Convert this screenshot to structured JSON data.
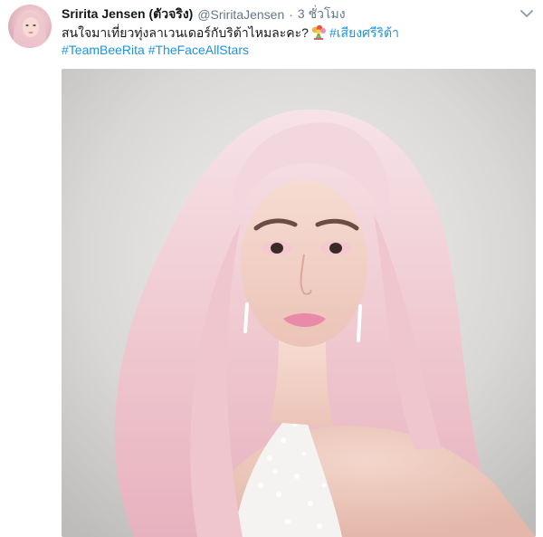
{
  "tweet": {
    "display_name": "Sririta Jensen (ตัวจริง)",
    "handle": "@SriritaJensen",
    "separator": "·",
    "timestamp": "3 ชั่วโมง",
    "body_text": "สนใจมาเที่ยวทุ่งลาเวนเดอร์กับริต้าไหมละคะ?",
    "emoji": "bouquet-emoji",
    "hashtags": {
      "h1": "#เสียงศรีริต้า",
      "h2": "#TeamBeeRita",
      "h3": "#TheFaceAllStars"
    },
    "menu_icon": "chevron-down-icon",
    "media_icon": "photo-image"
  },
  "colors": {
    "link": "#1b95e0",
    "name": "#14171a",
    "secondary": "#657786"
  }
}
